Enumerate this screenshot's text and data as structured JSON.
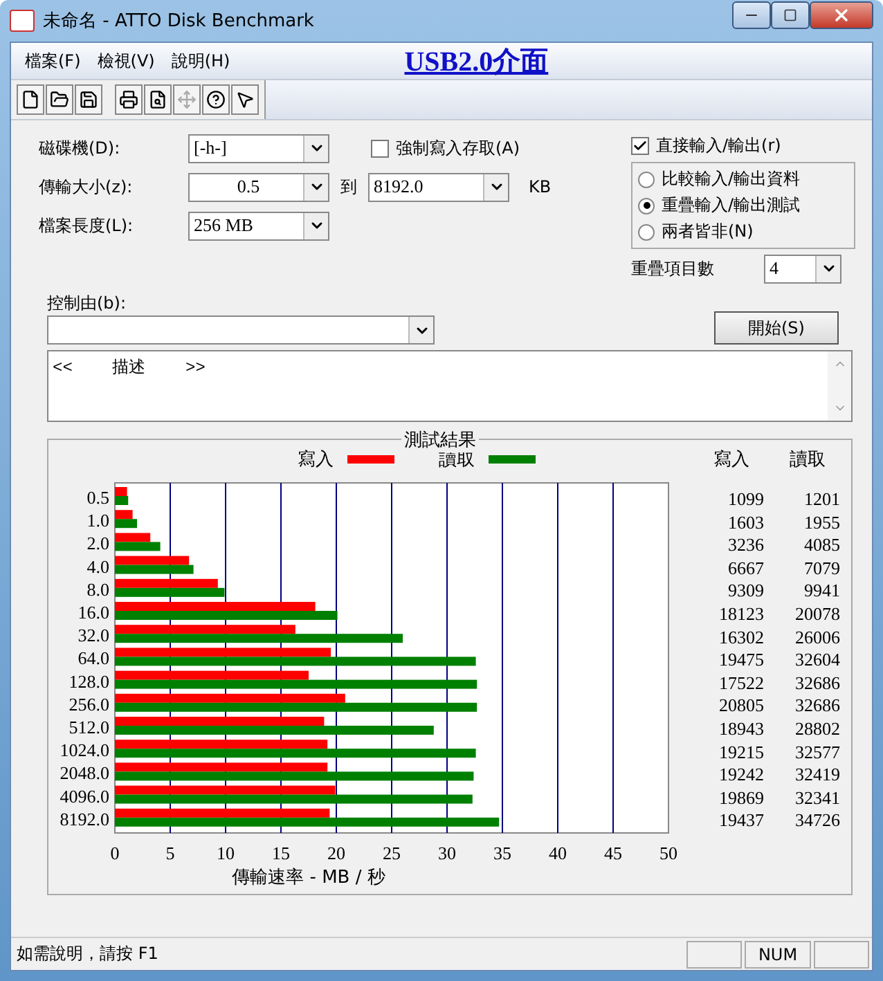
{
  "window": {
    "title": "未命名 - ATTO Disk Benchmark"
  },
  "menu": {
    "items": [
      {
        "label": "檔案(F)"
      },
      {
        "label": "檢視(V)"
      },
      {
        "label": "說明(H)"
      }
    ],
    "annotation": "USB2.0介面"
  },
  "toolbar": {
    "items": [
      {
        "kind": "new",
        "disabled": false
      },
      {
        "kind": "open",
        "disabled": false
      },
      {
        "kind": "save",
        "disabled": false
      },
      {
        "kind": "separator"
      },
      {
        "kind": "print",
        "disabled": false
      },
      {
        "kind": "preview",
        "disabled": false
      },
      {
        "kind": "move",
        "disabled": true
      },
      {
        "kind": "help",
        "disabled": false
      },
      {
        "kind": "context-help",
        "disabled": false
      }
    ]
  },
  "settings": {
    "drive": {
      "label": "磁碟機(D):",
      "value": "[-h-]"
    },
    "force_write": {
      "label": "強制寫入存取(A)",
      "checked": false
    },
    "direct_io": {
      "label": "直接輸入/輸出(r)",
      "checked": true
    },
    "transfer_size": {
      "label": "傳輸大小(z):",
      "from": "0.5",
      "to_label": "到",
      "to": "8192.0",
      "unit": "KB"
    },
    "file_length": {
      "label": "檔案長度(L):",
      "value": "256 MB"
    },
    "modes": [
      {
        "label": "比較輸入/輸出資料",
        "selected": false
      },
      {
        "label": "重疊輸入/輸出測試",
        "selected": true
      },
      {
        "label": "兩者皆非(N)",
        "selected": false
      }
    ],
    "queue_depth": {
      "label": "重疊項目數",
      "value": "4"
    },
    "controlled_by": {
      "label": "控制由(b):"
    },
    "start_button": "開始(S)",
    "description": "<<    描述    >>"
  },
  "results": {
    "title": "測試結果",
    "chart_data": {
      "type": "bar",
      "orientation": "horizontal",
      "grid": true,
      "xlabel": "傳輸速率 - MB / 秒",
      "xlim": [
        0,
        50
      ],
      "xticks": [
        0,
        5,
        10,
        15,
        20,
        25,
        30,
        35,
        40,
        45,
        50
      ],
      "categories": [
        "0.5",
        "1.0",
        "2.0",
        "4.0",
        "8.0",
        "16.0",
        "32.0",
        "64.0",
        "128.0",
        "256.0",
        "512.0",
        "1024.0",
        "2048.0",
        "4096.0",
        "8192.0"
      ],
      "series": [
        {
          "name": "寫入",
          "color": "#ff0000",
          "values": [
            1.1,
            1.6,
            3.2,
            6.7,
            9.3,
            18.1,
            16.3,
            19.5,
            17.5,
            20.8,
            18.9,
            19.2,
            19.2,
            19.9,
            19.4
          ]
        },
        {
          "name": "讀取",
          "color": "#008000",
          "values": [
            1.2,
            2.0,
            4.1,
            7.1,
            9.9,
            20.1,
            26.0,
            32.6,
            32.7,
            32.7,
            28.8,
            32.6,
            32.4,
            32.3,
            34.7
          ]
        }
      ]
    },
    "table": {
      "columns": [
        "寫入",
        "讀取"
      ],
      "rows": [
        [
          "1099",
          "1201"
        ],
        [
          "1603",
          "1955"
        ],
        [
          "3236",
          "4085"
        ],
        [
          "6667",
          "7079"
        ],
        [
          "9309",
          "9941"
        ],
        [
          "18123",
          "20078"
        ],
        [
          "16302",
          "26006"
        ],
        [
          "19475",
          "32604"
        ],
        [
          "17522",
          "32686"
        ],
        [
          "20805",
          "32686"
        ],
        [
          "18943",
          "28802"
        ],
        [
          "19215",
          "32577"
        ],
        [
          "19242",
          "32419"
        ],
        [
          "19869",
          "32341"
        ],
        [
          "19437",
          "34726"
        ]
      ]
    }
  },
  "status_bar": {
    "text": "如需說明，請按 F1",
    "indicator": "NUM"
  }
}
